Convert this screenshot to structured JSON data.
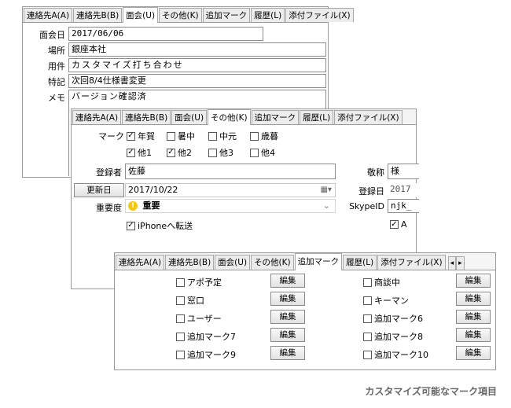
{
  "panel1": {
    "tabs": [
      "連絡先A(A)",
      "連絡先B(B)",
      "面会(U)",
      "その他(K)",
      "追加マーク",
      "履歴(L)",
      "添付ファイル(X)"
    ],
    "fields": [
      {
        "label": "面会日",
        "value": "2017/06/06"
      },
      {
        "label": "場所",
        "value": "銀座本社"
      },
      {
        "label": "用件",
        "value": "カスタマイズ打ち合わせ"
      },
      {
        "label": "特記",
        "value": "次回8/4仕様書変更"
      },
      {
        "label": "メモ",
        "value": "バージョン確認済"
      }
    ]
  },
  "panel2": {
    "tabs": [
      "連絡先A(A)",
      "連絡先B(B)",
      "面会(U)",
      "その他(K)",
      "追加マーク",
      "履歴(L)",
      "添付ファイル(X)"
    ],
    "mark_label": "マーク",
    "marks_row1": [
      {
        "label": "年賀",
        "checked": true
      },
      {
        "label": "暑中",
        "checked": false
      },
      {
        "label": "中元",
        "checked": false
      },
      {
        "label": "歳暮",
        "checked": false
      }
    ],
    "marks_row2": [
      {
        "label": "他1",
        "checked": true
      },
      {
        "label": "他2",
        "checked": true
      },
      {
        "label": "他3",
        "checked": false
      },
      {
        "label": "他4",
        "checked": false
      }
    ],
    "registrant_label": "登録者",
    "registrant_value": "佐藤",
    "honorific_label": "敬称",
    "honorific_value": "様",
    "updated_button": "更新日",
    "updated_value": "2017/10/22",
    "registered_label": "登録日",
    "registered_value": "2017",
    "importance_label": "重要度",
    "importance_value": "重要",
    "skype_label": "SkypeID",
    "skype_value": "njk_",
    "iphone_label": "iPhoneへ転送",
    "iphone_checked": true,
    "right_check_label": "A",
    "right_checked": true,
    "check_glyph": "✓",
    "importance_icon_glyph": "!",
    "calendar_glyph": "▦▾",
    "dropdown_glyph": "⌄"
  },
  "panel3": {
    "tabs": [
      "連絡先A(A)",
      "連絡先B(B)",
      "面会(U)",
      "その他(K)",
      "追加マーク",
      "履歴(L)",
      "添付ファイル(X)"
    ],
    "scroll_left": "◂",
    "scroll_right": "▸",
    "edit_label": "編集",
    "left_marks": [
      "アポ予定",
      "窓口",
      "ユーザー",
      "追加マーク7",
      "追加マーク9"
    ],
    "right_marks": [
      "商談中",
      "キーマン",
      "追加マーク6",
      "追加マーク8",
      "追加マーク10"
    ]
  },
  "caption": "カスタマイズ可能なマーク項目"
}
